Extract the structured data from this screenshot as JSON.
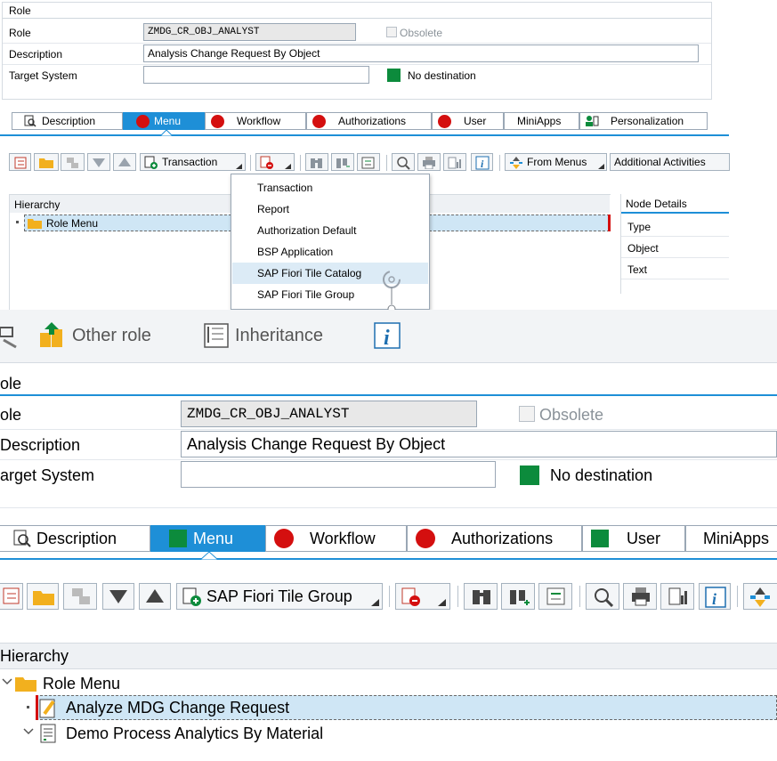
{
  "top": {
    "section_title": "Role",
    "fields": {
      "role_label": "Role",
      "role_value": "ZMDG_CR_OBJ_ANALYST",
      "obsolete_label": "Obsolete",
      "description_label": "Description",
      "description_value": "Analysis Change Request By Object",
      "target_system_label": "Target System",
      "target_system_value": "",
      "destination_text": "No destination"
    },
    "tabs": [
      "Description",
      "Menu",
      "Workflow",
      "Authorizations",
      "User",
      "MiniApps",
      "Personalization"
    ],
    "toolbar": {
      "transaction_label": "Transaction",
      "from_menus_label": "From Menus",
      "additional_activities_label": "Additional Activities"
    },
    "hierarchy": {
      "header": "Hierarchy",
      "root": "Role Menu"
    },
    "node_details": {
      "header": "Node Details",
      "rows": [
        "Type",
        "Object",
        "Text"
      ]
    },
    "dropdown_menu": {
      "items": [
        {
          "label": "Transaction",
          "hovered": false
        },
        {
          "label": "Report",
          "hovered": false
        },
        {
          "label": "Authorization Default",
          "hovered": false
        },
        {
          "label": "BSP Application",
          "hovered": false
        },
        {
          "label": "SAP Fiori Tile Catalog",
          "hovered": true
        },
        {
          "label": "SAP Fiori Tile Group",
          "hovered": false
        }
      ]
    }
  },
  "bottom": {
    "header_actions": {
      "other_role": "Other role",
      "inheritance": "Inheritance"
    },
    "section_title": "ole",
    "fields": {
      "role_label": "ole",
      "role_value": "ZMDG_CR_OBJ_ANALYST",
      "obsolete_label": "Obsolete",
      "description_label": "Description",
      "description_value": "Analysis Change Request By Object",
      "target_system_label": "arget System",
      "target_system_value": "",
      "destination_text": "No destination"
    },
    "tabs": [
      "Description",
      "Menu",
      "Workflow",
      "Authorizations",
      "User",
      "MiniApps"
    ],
    "toolbar": {
      "node_type_selected": "SAP Fiori Tile Group"
    },
    "hierarchy": {
      "header": "Hierarchy",
      "root": "Role Menu",
      "children": [
        "Analyze MDG Change Request",
        "Demo Process Analytics By Material"
      ]
    }
  },
  "colors": {
    "accent_blue": "#1e8fd7",
    "status_green": "#0c8b3c",
    "status_red": "#d40f0f",
    "folder_yellow": "#f2b01e",
    "selection_bg": "#cfe6f5"
  }
}
